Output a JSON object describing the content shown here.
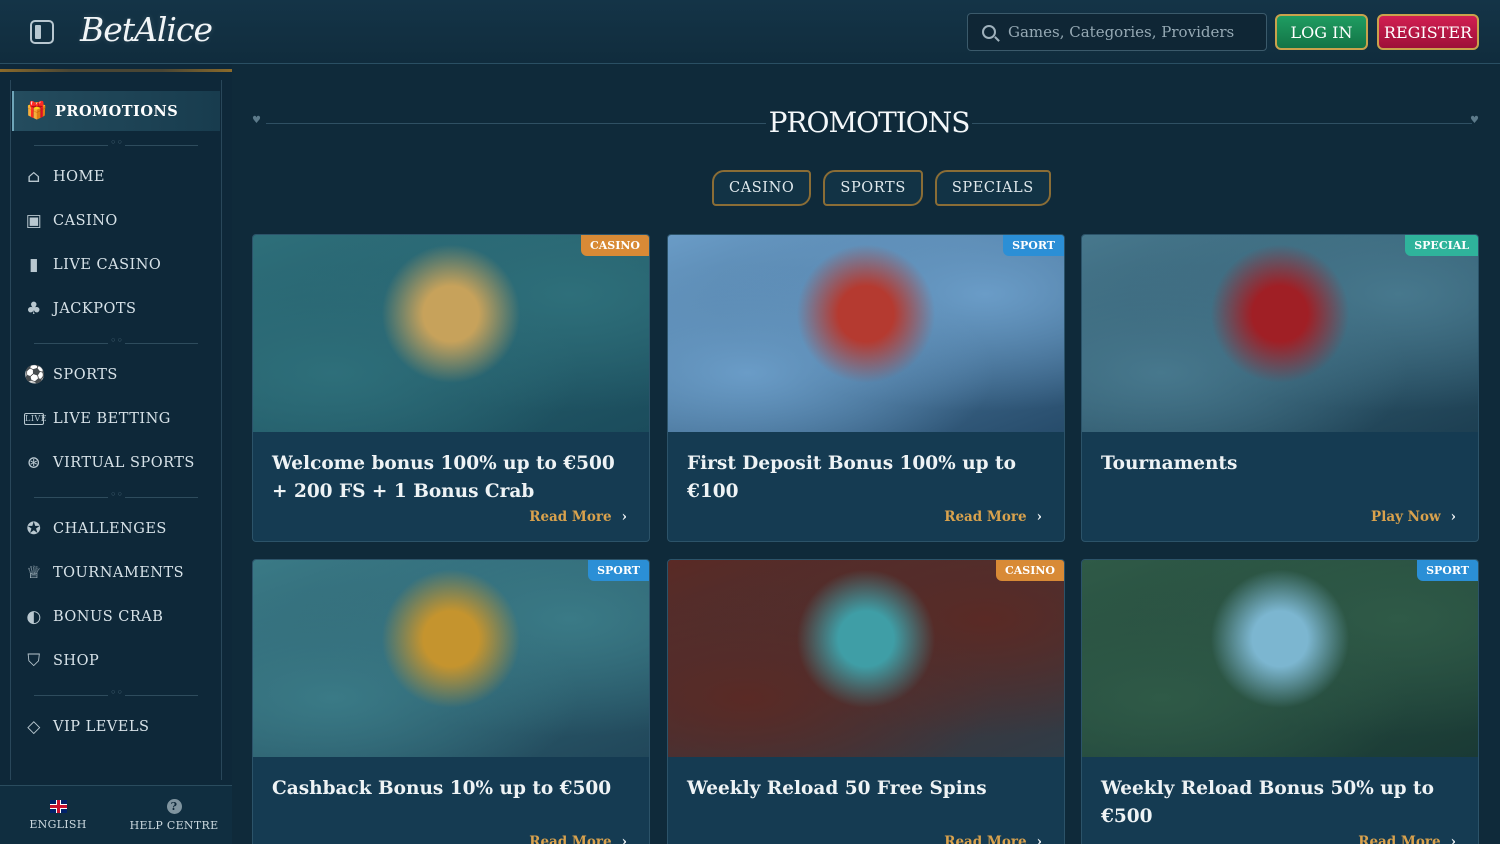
{
  "header": {
    "logo": "BetAlice",
    "search_placeholder": "Games, Categories, Providers",
    "login_label": "LOG IN",
    "register_label": "REGISTER"
  },
  "sidebar": {
    "active_item": "PROMOTIONS",
    "items": [
      {
        "label": "HOME",
        "icon": "home-icon"
      },
      {
        "label": "CASINO",
        "icon": "slot-machine-icon"
      },
      {
        "label": "LIVE CASINO",
        "icon": "card-icon"
      },
      {
        "label": "JACKPOTS",
        "icon": "clover-icon"
      },
      {
        "label": "SPORTS",
        "icon": "ball-icon"
      },
      {
        "label": "LIVE BETTING",
        "icon": "live-icon"
      },
      {
        "label": "VIRTUAL SPORTS",
        "icon": "virtual-icon"
      },
      {
        "label": "CHALLENGES",
        "icon": "medal-icon"
      },
      {
        "label": "TOURNAMENTS",
        "icon": "trophy-icon"
      },
      {
        "label": "BONUS CRAB",
        "icon": "crab-icon"
      },
      {
        "label": "SHOP",
        "icon": "basket-icon"
      },
      {
        "label": "VIP LEVELS",
        "icon": "diamond-icon"
      }
    ],
    "footer": {
      "language": "ENGLISH",
      "help": "HELP CENTRE"
    }
  },
  "main": {
    "title": "PROMOTIONS",
    "tabs": [
      "CASINO",
      "SPORTS",
      "SPECIALS"
    ],
    "cards": [
      {
        "badge": "CASINO",
        "badge_color": "#d88a36",
        "title": "Welcome bonus 100% up to €500 + 200 FS + 1 Bonus Crab",
        "link": "Read More",
        "colors": [
          "#2e6f7a",
          "#1b4c5c",
          "#c7a25b"
        ]
      },
      {
        "badge": "SPORT",
        "badge_color": "#2b8fd6",
        "title": "First Deposit Bonus 100% up to €100",
        "link": "Read More",
        "colors": [
          "#6a9cc7",
          "#274c6b",
          "#b53a30"
        ]
      },
      {
        "badge": "SPECIAL",
        "badge_color": "#2fb39b",
        "title": "Tournaments",
        "link": "Play Now",
        "colors": [
          "#47788d",
          "#1d3f52",
          "#a01f25"
        ]
      },
      {
        "badge": "SPORT",
        "badge_color": "#2b8fd6",
        "title": "Cashback Bonus 10% up to €500",
        "link": "Read More",
        "colors": [
          "#3a7a86",
          "#21475a",
          "#c5942e"
        ]
      },
      {
        "badge": "CASINO",
        "badge_color": "#d88a36",
        "title": "Weekly Reload 50 Free Spins",
        "link": "Read More",
        "colors": [
          "#5a2a25",
          "#2f3c47",
          "#3f9ea6"
        ]
      },
      {
        "badge": "SPORT",
        "badge_color": "#2b8fd6",
        "title": "Weekly Reload Bonus 50% up to €500",
        "link": "Read More",
        "colors": [
          "#2f5a47",
          "#1a3a35",
          "#7cb6d0"
        ]
      }
    ]
  }
}
